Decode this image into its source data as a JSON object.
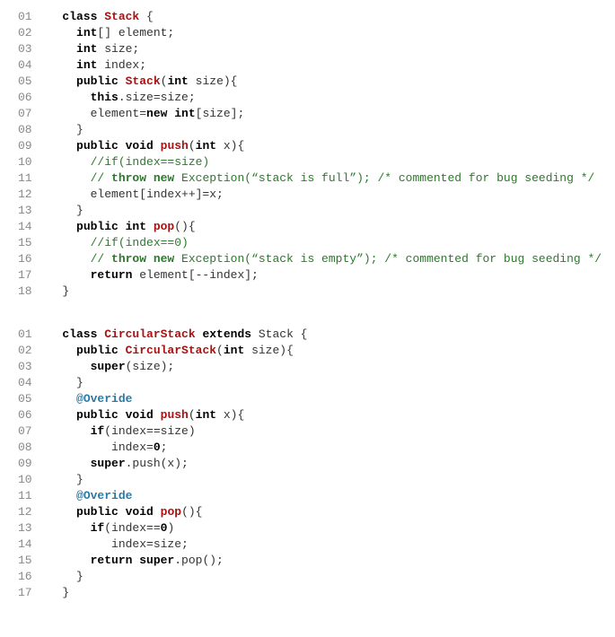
{
  "block1": {
    "ln01": "01",
    "ln02": "02",
    "ln03": "03",
    "ln04": "04",
    "ln05": "05",
    "ln06": "06",
    "ln07": "07",
    "ln08": "08",
    "ln09": "09",
    "ln10": "10",
    "ln11": "11",
    "ln12": "12",
    "ln13": "13",
    "ln14": "14",
    "ln15": "15",
    "ln16": "16",
    "ln17": "17",
    "ln18": "18",
    "l01_kw1": "class",
    "l01_cls": " Stack",
    "l01_r": " {",
    "l02_kw": "int",
    "l02_r": "[] element;",
    "l03_kw": "int",
    "l03_r": " size;",
    "l04_kw": "int",
    "l04_r": " index;",
    "l05_kw1": "public",
    "l05_ctor": " Stack",
    "l05_mid": "(",
    "l05_kw2": "int",
    "l05_r": " size){",
    "l06_kw": "this",
    "l06_r": ".size=size;",
    "l07_a": "element=",
    "l07_kw": "new int",
    "l07_r": "[size];",
    "l08": "}",
    "l09_kw1": "public void",
    "l09_mth": " push",
    "l09_mid": "(",
    "l09_kw2": "int",
    "l09_r": " x){",
    "l10_cmt": "//if(index==size)",
    "l11_cmt1": "//",
    "l11_kw": " throw new",
    "l11_cmt2": " Exception(“stack is full”); /* commented for bug seeding */",
    "l12": "element[index++]=x;",
    "l13": "}",
    "l14_kw1": "public int",
    "l14_mth": " pop",
    "l14_r": "(){",
    "l15_cmt": "//if(index==0)",
    "l16_cmt1": "//",
    "l16_kw": " throw new",
    "l16_cmt2": " Exception(“stack is empty”); /* commented for bug seeding */",
    "l17_kw": "return",
    "l17_r": " element[--index];",
    "l18": "}"
  },
  "block2": {
    "ln01": "01",
    "ln02": "02",
    "ln03": "03",
    "ln04": "04",
    "ln05": "05",
    "ln06": "06",
    "ln07": "07",
    "ln08": "08",
    "ln09": "09",
    "ln10": "10",
    "ln11": "11",
    "ln12": "12",
    "ln13": "13",
    "ln14": "14",
    "ln15": "15",
    "ln16": "16",
    "ln17": "17",
    "l01_kw1": "class",
    "l01_cls": " CircularStack",
    "l01_kw2": " extends",
    "l01_base": " Stack",
    "l01_r": " {",
    "l02_kw": "public",
    "l02_ctor": " CircularStack",
    "l02_mid": "(",
    "l02_kw2": "int",
    "l02_r": " size){",
    "l03_kw": "super",
    "l03_r": "(size);",
    "l04": "}",
    "l05_ann": "@Overide",
    "l06_kw1": "public void",
    "l06_mth": " push",
    "l06_mid": "(",
    "l06_kw2": "int",
    "l06_r": " x){",
    "l07_kw": "if",
    "l07_r": "(index==size)",
    "l08_a": "index=",
    "l08_num": "0",
    "l08_r": ";",
    "l09_kw": "super",
    "l09_r": ".push(x);",
    "l10": "}",
    "l11_ann": "@Overide",
    "l12_kw1": "public void",
    "l12_mth": " pop",
    "l12_r": "(){",
    "l13_kw": "if",
    "l13_a": "(index==",
    "l13_num": "0",
    "l13_r": ")",
    "l14": "index=size;",
    "l15_kw1": "return super",
    "l15_r": ".pop();",
    "l16": "}",
    "l17": "}"
  }
}
